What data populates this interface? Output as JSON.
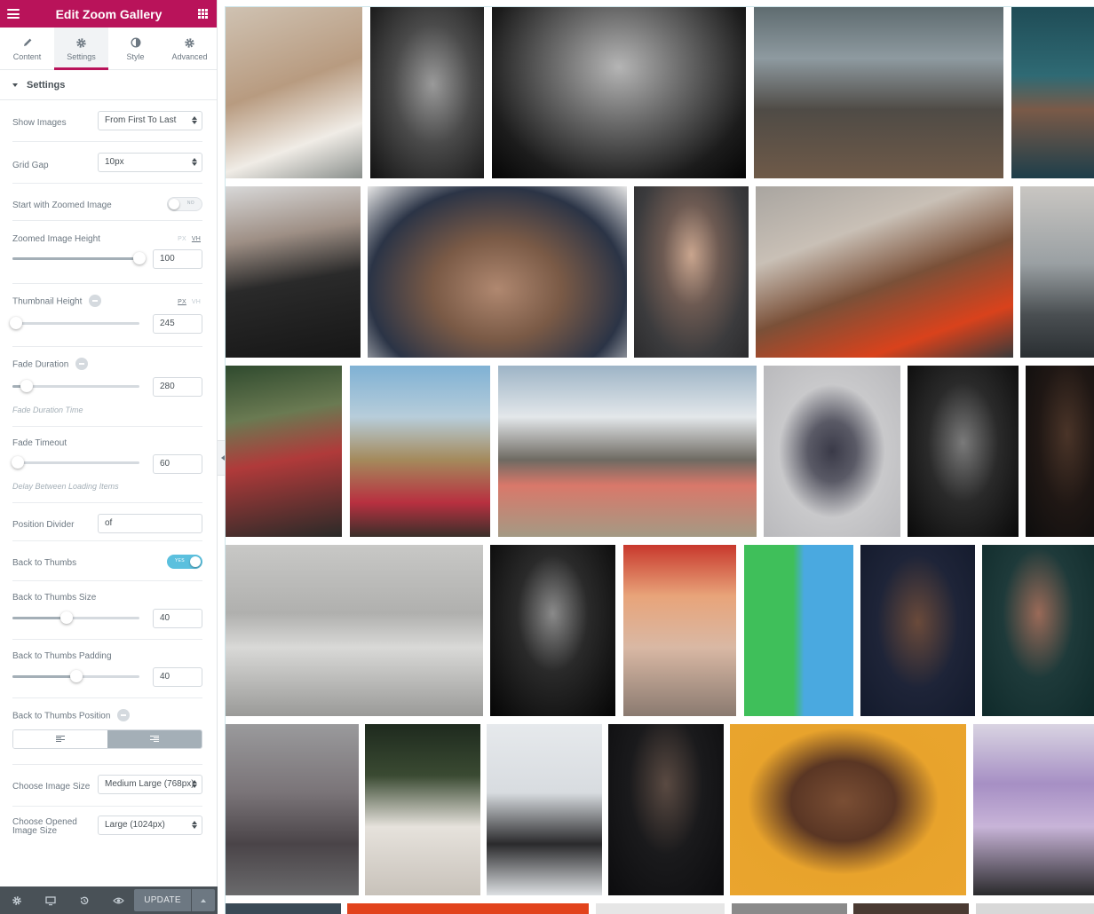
{
  "header": {
    "title": "Edit Zoom Gallery",
    "menu_icon": "hamburger-icon",
    "apps_icon": "grid-icon"
  },
  "tabs": [
    {
      "label": "Content",
      "icon": "pencil-icon",
      "active": false
    },
    {
      "label": "Settings",
      "icon": "gear-icon",
      "active": true
    },
    {
      "label": "Style",
      "icon": "contrast-icon",
      "active": false
    },
    {
      "label": "Advanced",
      "icon": "gear-icon",
      "active": false
    }
  ],
  "section": {
    "title": "Settings"
  },
  "controls": {
    "show_images": {
      "label": "Show Images",
      "value": "From First To Last"
    },
    "grid_gap": {
      "label": "Grid Gap",
      "value": "10px"
    },
    "start_zoomed": {
      "label": "Start with Zoomed Image",
      "state": "NO"
    },
    "zoomed_height": {
      "label": "Zoomed Image Height",
      "unit_px": "PX",
      "unit_vh": "VH",
      "value": "100",
      "level": 1.0
    },
    "thumb_height": {
      "label": "Thumbnail Height",
      "unit_px": "PX",
      "unit_vh": "VH",
      "value": "245",
      "level": 0.0
    },
    "fade_duration": {
      "label": "Fade Duration",
      "value": "280",
      "hint": "Fade Duration Time",
      "level": 0.11
    },
    "fade_timeout": {
      "label": "Fade Timeout",
      "value": "60",
      "hint": "Delay Between Loading Items",
      "level": 0.0
    },
    "position_divider": {
      "label": "Position Divider",
      "value": "of"
    },
    "back_to_thumbs": {
      "label": "Back to Thumbs",
      "state": "YES"
    },
    "back_size": {
      "label": "Back to Thumbs Size",
      "value": "40",
      "level": 0.43
    },
    "back_padding": {
      "label": "Back to Thumbs Padding",
      "value": "40",
      "level": 0.5
    },
    "back_position": {
      "label": "Back to Thumbs Position",
      "selected": "right"
    },
    "image_size": {
      "label": "Choose Image Size",
      "value": "Medium Large (768px)"
    },
    "opened_size": {
      "label": "Choose Opened Image Size",
      "value": "Large (1024px)"
    }
  },
  "footer": {
    "update_label": "UPDATE",
    "icons": [
      "gear-icon",
      "desktop-icon",
      "history-icon",
      "eye-icon"
    ]
  },
  "colors": {
    "brand": "#b9135a",
    "toggle_on": "#5bc0de",
    "panel_bg": "#f1f3f5",
    "footer_bg": "#495157"
  }
}
